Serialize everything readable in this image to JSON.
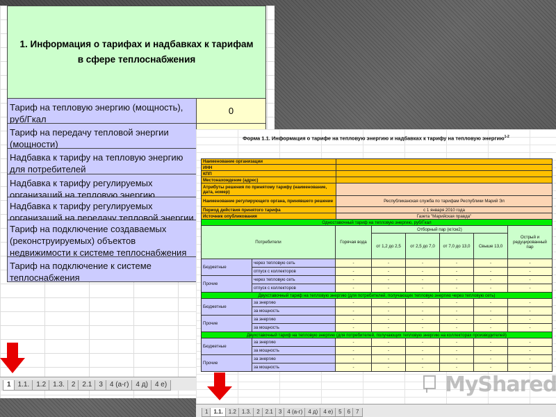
{
  "back_sheet": {
    "header": "1. Информация о тарифах и надбавках к тарифам в сфере теплоснабжения",
    "rows": [
      {
        "label": "Тариф на тепловую энергию (мощность), руб/Гкал",
        "value": "0"
      },
      {
        "label": "Тариф на передачу тепловой энергии (мощности)",
        "value": ""
      },
      {
        "label": "Надбавка к тарифу на тепловую энергию для потребителей",
        "value": ""
      },
      {
        "label": "Надбавка к тарифу регулируемых организаций на тепловую энергию",
        "value": ""
      },
      {
        "label": "Надбавка к тарифу регулируемых организаций на передачу тепловой энергии",
        "value": ""
      },
      {
        "label": "Тариф на подключение создаваемых (реконструируемых) объектов недвижимости к системе теплоснабжения",
        "value": ""
      },
      {
        "label": "Тариф на подключение к системе теплоснабжения",
        "value": ""
      }
    ],
    "tabs": [
      "1",
      "1.1.",
      "1.2",
      "1.3.",
      "2",
      "2.1",
      "3",
      "4 (а-г)",
      "4 д)",
      "4 е)"
    ],
    "active_tab": "1"
  },
  "front_sheet": {
    "title": "Форма 1.1. Информация о тарифе на тепловую энергию и надбавках к тарифу на тепловую энергию",
    "title_sup": "1-2",
    "info_rows": [
      {
        "label": "Наименование организации",
        "value": ""
      },
      {
        "label": "ИНН",
        "value": ""
      },
      {
        "label": "КПП",
        "value": ""
      },
      {
        "label": "Местонахождение (адрес)",
        "value": ""
      },
      {
        "label": "Атрибуты решения по принятому тарифу (наименование, дата, номер)",
        "value": ""
      },
      {
        "label": "Наименование регулирующего органа, принявшего решение",
        "value": "Республиканская служба по тарифам Республики Марий Эл"
      },
      {
        "label": "Период действия принятого тарифа",
        "value": "с 1 января 2010 года"
      },
      {
        "label": "Источник опубликования",
        "value": "Газета \"Марийская правда\""
      }
    ],
    "section1": "Одноставочный тариф на тепловую энергию, руб/Гкал",
    "table_header": {
      "consumers": "Потребители",
      "hot_water": "Горячая вода",
      "steam": "Отборный пар (кг/см2)",
      "steam_cols": [
        "от 1,2 до 2,5",
        "от 2,5 до 7,0",
        "от 7,0 до 13,0",
        "Свыше 13,0"
      ],
      "sharp": "Острый и редуцированный пар"
    },
    "s1_groups": [
      {
        "name": "Бюджетные",
        "subs": [
          "через тепловую сеть",
          "отпуск с коллекторов"
        ]
      },
      {
        "name": "Прочие",
        "subs": [
          "через тепловую сеть",
          "отпуск с коллекторов"
        ]
      }
    ],
    "section2": "Двухставочный тариф на тепловую энергию (для потребителей, получающих тепловую энергию через тепловую сеть)",
    "s2_groups": [
      {
        "name": "Бюджетные",
        "subs": [
          "за энергию",
          "за мощность"
        ]
      },
      {
        "name": "Прочие",
        "subs": [
          "за энергию",
          "за мощность"
        ]
      }
    ],
    "section3": "Двухставочный тариф на тепловую энергию (для потребителей, получающих тепловую энергию на коллекторах производителей)",
    "s3_groups": [
      {
        "name": "Бюджетные",
        "subs": [
          "за энергию",
          "за мощность"
        ]
      },
      {
        "name": "Прочие",
        "subs": [
          "за энергию",
          "за мощность"
        ]
      }
    ],
    "dash": "-",
    "tabs": [
      "1",
      "1.1.",
      "1.2",
      "1.3.",
      "2",
      "2.1",
      "3",
      "4 (а-г)",
      "4 д)",
      "4 е)",
      "5",
      "6",
      "7"
    ],
    "active_tab": "1.1."
  },
  "watermark": "MyShared",
  "colors": {
    "arrow": "#e60000",
    "header_green": "#ccffcc",
    "label_blue": "#ccccff",
    "label_orange": "#ffc000"
  }
}
